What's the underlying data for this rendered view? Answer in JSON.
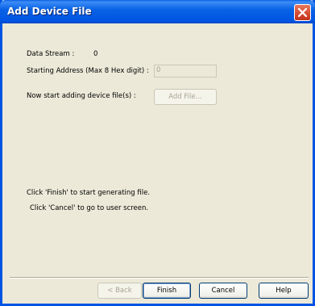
{
  "window": {
    "title": "Add Device File"
  },
  "form": {
    "data_stream_label": "Data Stream :",
    "data_stream_value": "0",
    "start_address_label": "Starting Address (Max 8 Hex digit) :",
    "start_address_value": "0",
    "add_files_label": "Now start adding device file(s) :",
    "add_file_button": "Add File..."
  },
  "instructions": {
    "finish_hint": "Click 'Finish' to start generating file.",
    "cancel_hint": "Click 'Cancel' to go to user screen."
  },
  "buttons": {
    "back": "< Back",
    "finish": "Finish",
    "cancel": "Cancel",
    "help": "Help"
  }
}
